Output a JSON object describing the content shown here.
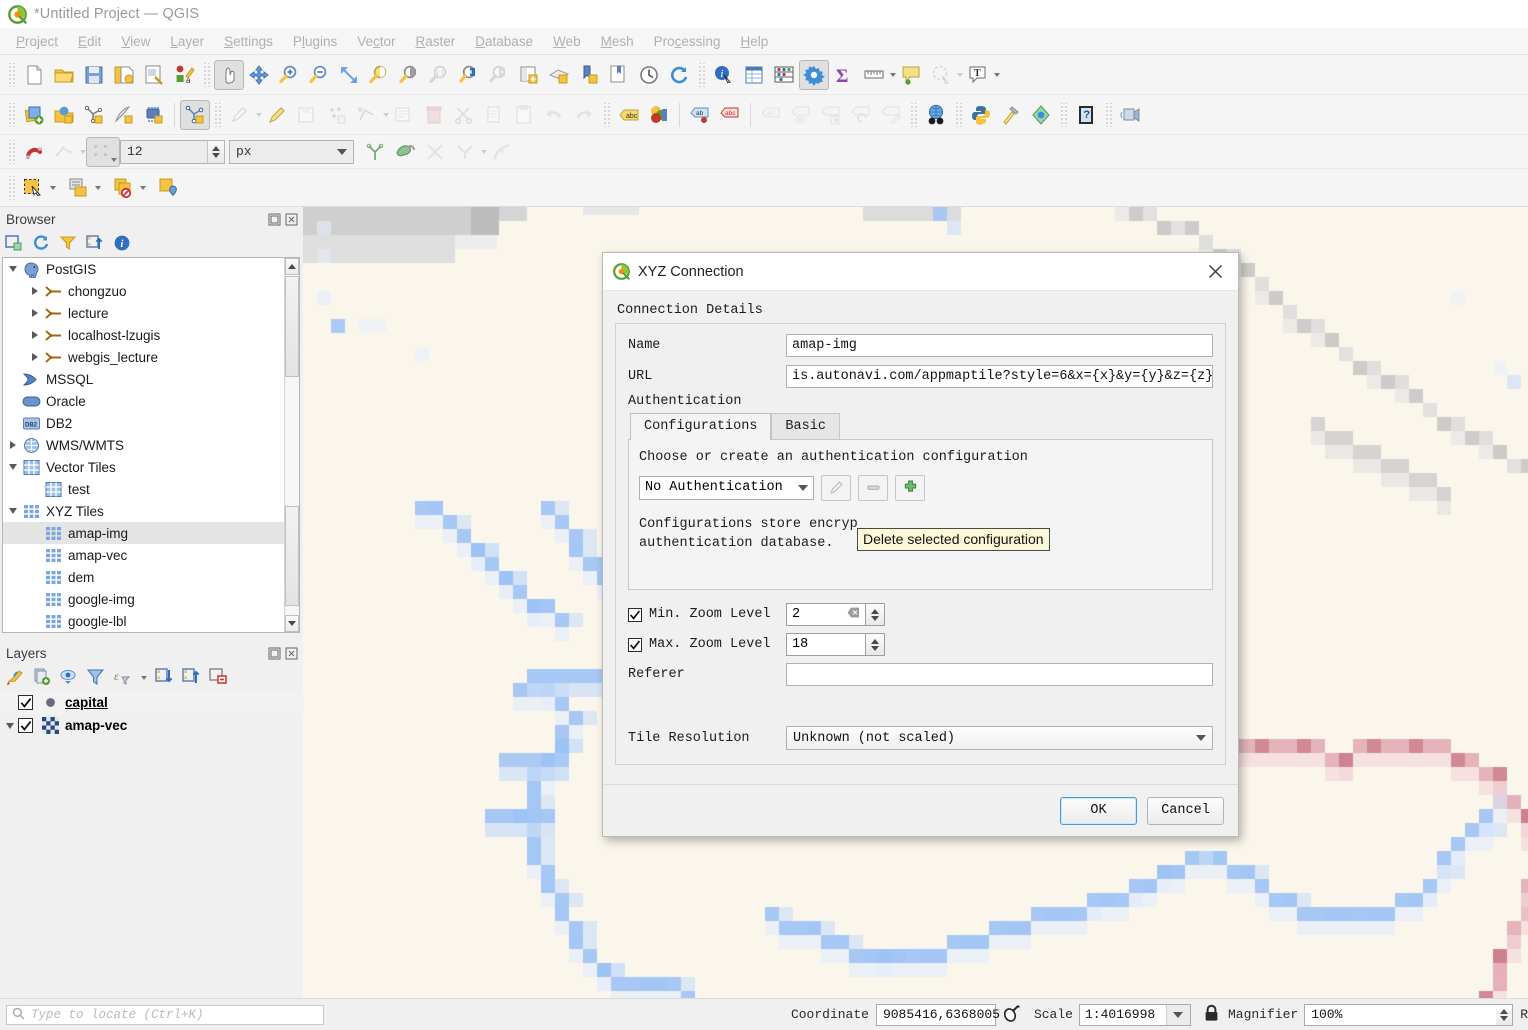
{
  "window": {
    "title": "*Untitled Project — QGIS",
    "logo_icon": "qgis-logo-icon"
  },
  "menubar": {
    "items": [
      {
        "label": "Project",
        "accel": "P"
      },
      {
        "label": "Edit",
        "accel": "E"
      },
      {
        "label": "View",
        "accel": "V"
      },
      {
        "label": "Layer",
        "accel": "L"
      },
      {
        "label": "Settings",
        "accel": "S"
      },
      {
        "label": "Plugins",
        "accel": "P"
      },
      {
        "label": "Vector",
        "accel": "V"
      },
      {
        "label": "Raster",
        "accel": "R"
      },
      {
        "label": "Database",
        "accel": "D"
      },
      {
        "label": "Web",
        "accel": "W"
      },
      {
        "label": "Mesh",
        "accel": "M"
      },
      {
        "label": "Processing",
        "accel": "c"
      },
      {
        "label": "Help",
        "accel": "H"
      }
    ]
  },
  "toolbars": {
    "row1": [
      "new-project-icon",
      "open-project-icon",
      "save-project-icon",
      "save-project-as-icon",
      "new-print-layout-icon",
      "style-manager-icon",
      "pan-map-icon",
      "pan-to-selection-icon",
      "zoom-in-icon",
      "zoom-out-icon",
      "zoom-full-icon",
      "zoom-to-selection-icon",
      "zoom-to-layer-icon",
      "zoom-native-icon",
      "zoom-last-icon",
      "zoom-next-icon",
      "new-map-view-icon",
      "new-3d-map-view-icon",
      "bookmark-icon",
      "show-bookmarks-icon",
      "temporal-controller-icon",
      "refresh-icon",
      "identify-features-icon",
      "open-attribute-table-icon",
      "field-calculator-icon",
      "processing-toolbox-icon",
      "statistical-summary-icon",
      "measure-line-icon",
      "map-tips-icon",
      "annotation-icon",
      "text-annotation-icon"
    ],
    "row2": [
      "add-vector-layer-icon",
      "add-raster-layer-icon",
      "add-mesh-layer-icon",
      "add-delimited-text-icon",
      "add-postgis-layer-icon",
      "add-vector-tile-icon",
      "current-edits-icon",
      "toggle-editing-icon",
      "save-layer-edits-icon",
      "add-feature-icon",
      "vertex-tool-icon",
      "modify-attributes-icon",
      "delete-selected-icon",
      "cut-features-icon",
      "copy-features-icon",
      "paste-features-icon",
      "undo-icon",
      "redo-icon",
      "label-icon",
      "styling-icon",
      "highlight-pinned-labels-icon",
      "pin-labels-icon",
      "show-hide-labels-icon",
      "move-label-icon",
      "rotate-label-icon",
      "change-label-icon",
      "osm-place-search-icon",
      "python-console-icon",
      "plugin-builder-icon",
      "georeferencer-icon",
      "help-icon",
      "messages-icon"
    ],
    "row3": {
      "snapping_icon": "magnet-icon",
      "snap-mode-icon": "snapping-mode-icon",
      "tolerance_value": "12",
      "units_value": "px",
      "extra_icons": [
        "snap-intersection-icon",
        "topological-editing-icon",
        "avoid-overlap-icon",
        "trace-icon",
        "follow-advanced-icon"
      ]
    },
    "row4": [
      "select-features-icon",
      "select-by-expression-icon",
      "deselect-features-icon",
      "select-by-location-icon"
    ]
  },
  "browser": {
    "title": "Browser",
    "tools": [
      "add-layer-icon",
      "refresh-icon",
      "filter-icon",
      "collapse-all-icon",
      "properties-info-icon"
    ],
    "actions": [
      "dock-undock-icon",
      "close-icon"
    ],
    "tree": [
      {
        "label": "PostGIS",
        "icon": "postgis-elephant-icon",
        "indent": 0,
        "expander": "down",
        "selected": false
      },
      {
        "label": "chongzuo",
        "icon": "postgis-connection-icon",
        "indent": 1,
        "expander": "right",
        "selected": false
      },
      {
        "label": "lecture",
        "icon": "postgis-connection-icon",
        "indent": 1,
        "expander": "right",
        "selected": false
      },
      {
        "label": "localhost-lzugis",
        "icon": "postgis-connection-icon",
        "indent": 1,
        "expander": "right",
        "selected": false
      },
      {
        "label": "webgis_lecture",
        "icon": "postgis-connection-icon",
        "indent": 1,
        "expander": "right",
        "selected": false
      },
      {
        "label": "MSSQL",
        "icon": "mssql-icon",
        "indent": 0,
        "expander": "none",
        "selected": false
      },
      {
        "label": "Oracle",
        "icon": "oracle-icon",
        "indent": 0,
        "expander": "none",
        "selected": false
      },
      {
        "label": "DB2",
        "icon": "db2-icon",
        "indent": 0,
        "expander": "none",
        "selected": false
      },
      {
        "label": "WMS/WMTS",
        "icon": "wms-globe-icon",
        "indent": 0,
        "expander": "right",
        "selected": false
      },
      {
        "label": "Vector Tiles",
        "icon": "vector-tiles-icon",
        "indent": 0,
        "expander": "down",
        "selected": false
      },
      {
        "label": "test",
        "icon": "vector-tiles-icon",
        "indent": 1,
        "expander": "none",
        "selected": false
      },
      {
        "label": "XYZ Tiles",
        "icon": "xyz-tiles-icon",
        "indent": 0,
        "expander": "down",
        "selected": false
      },
      {
        "label": "amap-img",
        "icon": "xyz-tiles-icon",
        "indent": 1,
        "expander": "none",
        "selected": true
      },
      {
        "label": "amap-vec",
        "icon": "xyz-tiles-icon",
        "indent": 1,
        "expander": "none",
        "selected": false
      },
      {
        "label": "dem",
        "icon": "xyz-tiles-icon",
        "indent": 1,
        "expander": "none",
        "selected": false
      },
      {
        "label": "google-img",
        "icon": "xyz-tiles-icon",
        "indent": 1,
        "expander": "none",
        "selected": false
      },
      {
        "label": "google-lbl",
        "icon": "xyz-tiles-icon",
        "indent": 1,
        "expander": "none",
        "selected": false
      }
    ]
  },
  "layers": {
    "title": "Layers",
    "tools": [
      "open-layer-styling-icon",
      "add-group-icon",
      "manage-map-themes-icon",
      "filter-legend-icon",
      "filter-legend-expression-icon",
      "expand-all-icon",
      "collapse-all-icon",
      "remove-layer-icon"
    ],
    "items": [
      {
        "label": "capital",
        "icon": "point-symbol-icon",
        "checked": true,
        "expander": "none",
        "selected": true
      },
      {
        "label": "amap-vec",
        "icon": "raster-symbol-icon",
        "checked": true,
        "expander": "down",
        "selected": false
      }
    ]
  },
  "dialog": {
    "title": "XYZ Connection",
    "logo_icon": "qgis-logo-icon",
    "close_icon": "close-icon",
    "section_label": "Connection Details",
    "fields": {
      "name_label": "Name",
      "name_value": "amap-img",
      "url_label": "URL",
      "url_value": "is.autonavi.com/appmaptile?style=6&x={x}&y={y}&z={z}",
      "auth_label": "Authentication"
    },
    "auth": {
      "tabs": [
        {
          "label": "Configurations",
          "active": true
        },
        {
          "label": "Basic",
          "active": false
        }
      ],
      "hint": "Choose or create an authentication configuration",
      "combo_value": "No Authentication",
      "buttons": [
        {
          "name": "edit-configuration-button",
          "icon": "pencil-icon",
          "disabled": true
        },
        {
          "name": "remove-configuration-button",
          "icon": "minus-icon",
          "disabled": true
        },
        {
          "name": "add-configuration-button",
          "icon": "plus-icon",
          "disabled": false
        }
      ],
      "note_line1": "Configurations store encryp",
      "note_line2": "authentication database.",
      "tooltip": "Delete selected configuration"
    },
    "zoom": {
      "min_label": "Min. Zoom Level",
      "min_checked": true,
      "min_value": "2",
      "max_label": "Max. Zoom Level",
      "max_checked": true,
      "max_value": "18"
    },
    "referer_label": "Referer",
    "referer_value": "",
    "tile_resolution_label": "Tile Resolution",
    "tile_resolution_value": "Unknown (not scaled)",
    "ok_label": "OK",
    "cancel_label": "Cancel"
  },
  "statusbar": {
    "locate_placeholder": "Type to locate (Ctrl+K)",
    "locate_icon": "search-icon",
    "coordinate_label": "Coordinate",
    "coordinate_value": "9085416,6368005",
    "coordinate_toggle_icon": "toggle-extents-icon",
    "scale_label": "Scale",
    "scale_value": "1:4016998",
    "lock_icon": "lock-scale-icon",
    "magnifier_label": "Magnifier",
    "magnifier_value": "100%",
    "rotation_label": "R"
  },
  "colors": {
    "map_background": "#faf6ec",
    "water_blue": "#9dc2f5",
    "road_red": "#cd7f8e",
    "accent_blue": "#3d9de0",
    "tooltip_bg": "#fbf8d8",
    "selection_gray": "#e4e4e4"
  }
}
